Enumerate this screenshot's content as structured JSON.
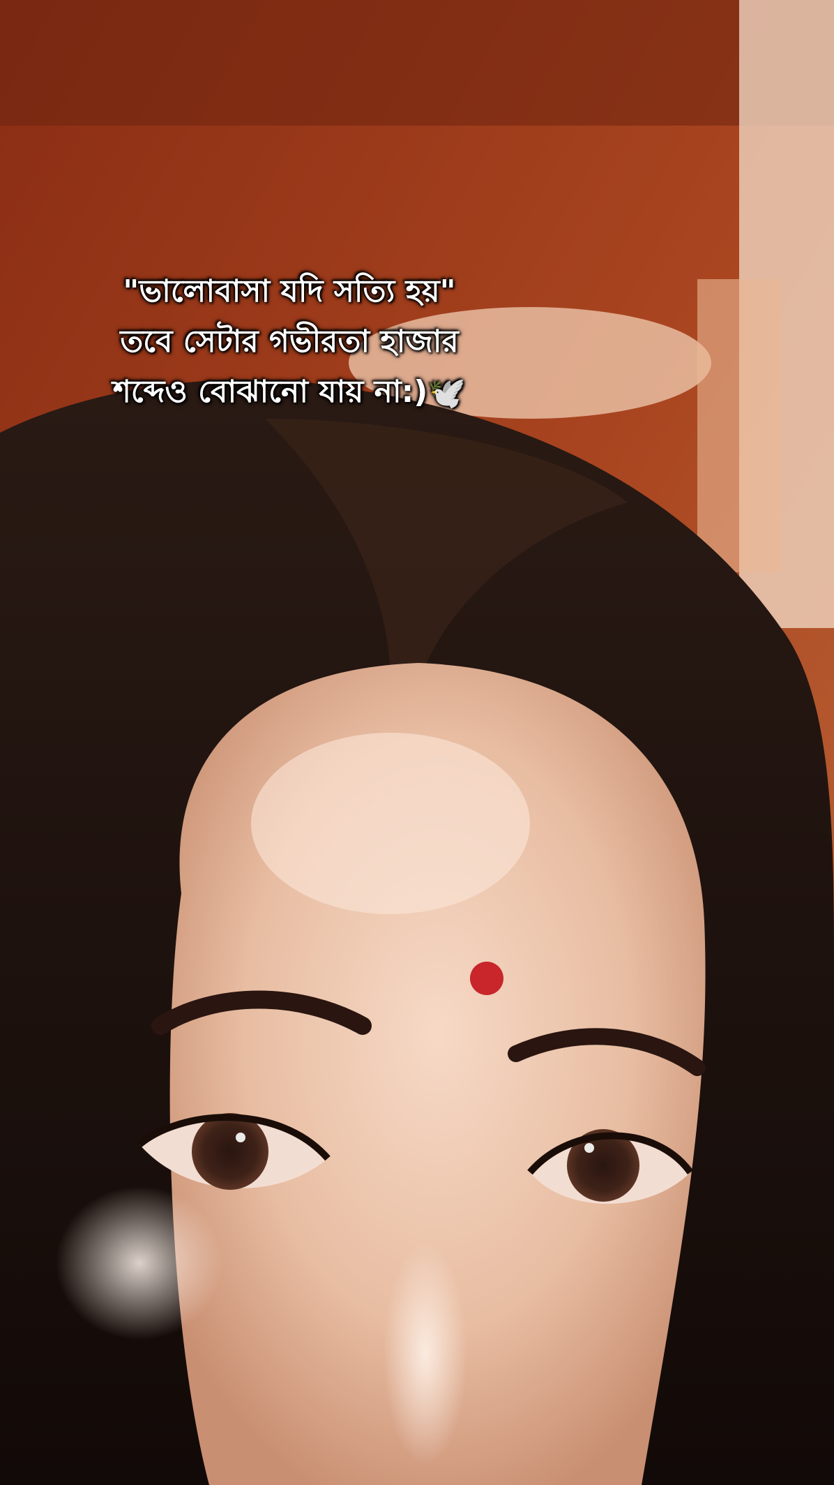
{
  "caption": {
    "line1": "\"ভালোবাসা যদি সত্যি হয়\"",
    "line2": "তবে সেটার গভীরতা হাজার",
    "line3": "শব্দেও বোঝানো যায় না:)",
    "emoji": "🕊️"
  },
  "colors": {
    "background_wall": "#9a3a1c",
    "hair": "#1c1210",
    "skin": "#e9c0a6",
    "bindi": "#c8262a",
    "caption_text": "#ffffff"
  },
  "icons": {
    "dove": "dove-icon"
  }
}
